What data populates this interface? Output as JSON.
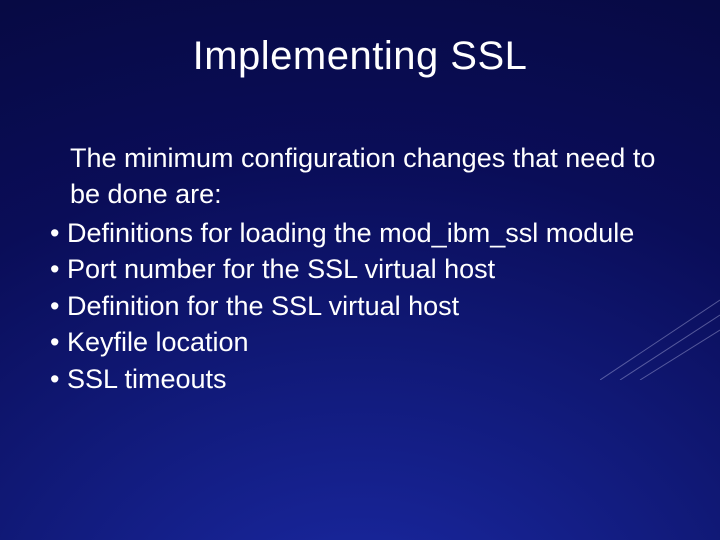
{
  "slide": {
    "title": "Implementing SSL",
    "intro": "The minimum configuration changes that need to be done are:",
    "bullets": [
      "Definitions for loading the mod_ibm_ssl module",
      "Port number for the SSL virtual host",
      "Definition for the SSL virtual host",
      "Keyfile location",
      "SSL timeouts"
    ]
  }
}
